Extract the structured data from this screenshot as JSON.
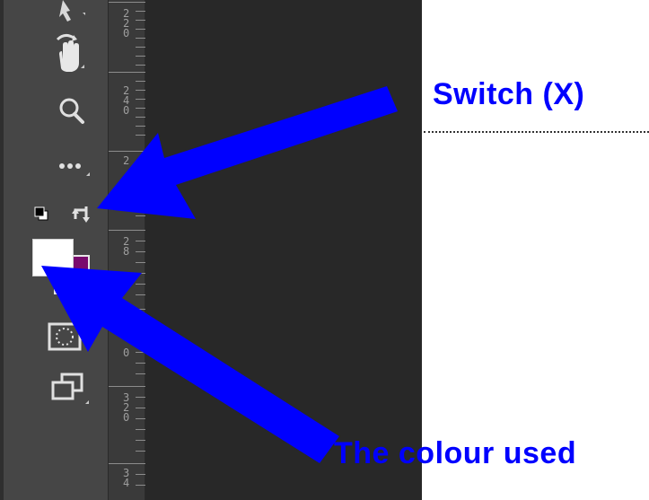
{
  "ruler": {
    "labels": [
      "2\n2\n0",
      "2\n4\n0",
      "2",
      "2\n8",
      "0",
      "3\n2\n0",
      "3\n4"
    ]
  },
  "toolbar": {
    "tools": [
      {
        "name": "move-tool-icon",
        "icon": "arrow-cursor"
      },
      {
        "name": "hand-tool-icon",
        "icon": "hand-rotate"
      },
      {
        "name": "zoom-tool-icon",
        "icon": "magnifier"
      },
      {
        "name": "more-tools-icon",
        "icon": "ellipsis"
      },
      {
        "name": "default-colors-icon",
        "icon": "default-colors"
      },
      {
        "name": "switch-colors-icon",
        "icon": "swap-arrows"
      },
      {
        "name": "foreground-color-swatch",
        "icon": "swatch"
      },
      {
        "name": "quick-mask-icon",
        "icon": "quick-mask"
      },
      {
        "name": "screen-mode-icon",
        "icon": "screen-mode"
      }
    ],
    "foreground_color": "#ffffff",
    "background_color": "#7a0a6e"
  },
  "annotations": {
    "switch_label": "Switch (X)",
    "colour_label": "The colour used",
    "arrow_color": "#0000ff"
  }
}
